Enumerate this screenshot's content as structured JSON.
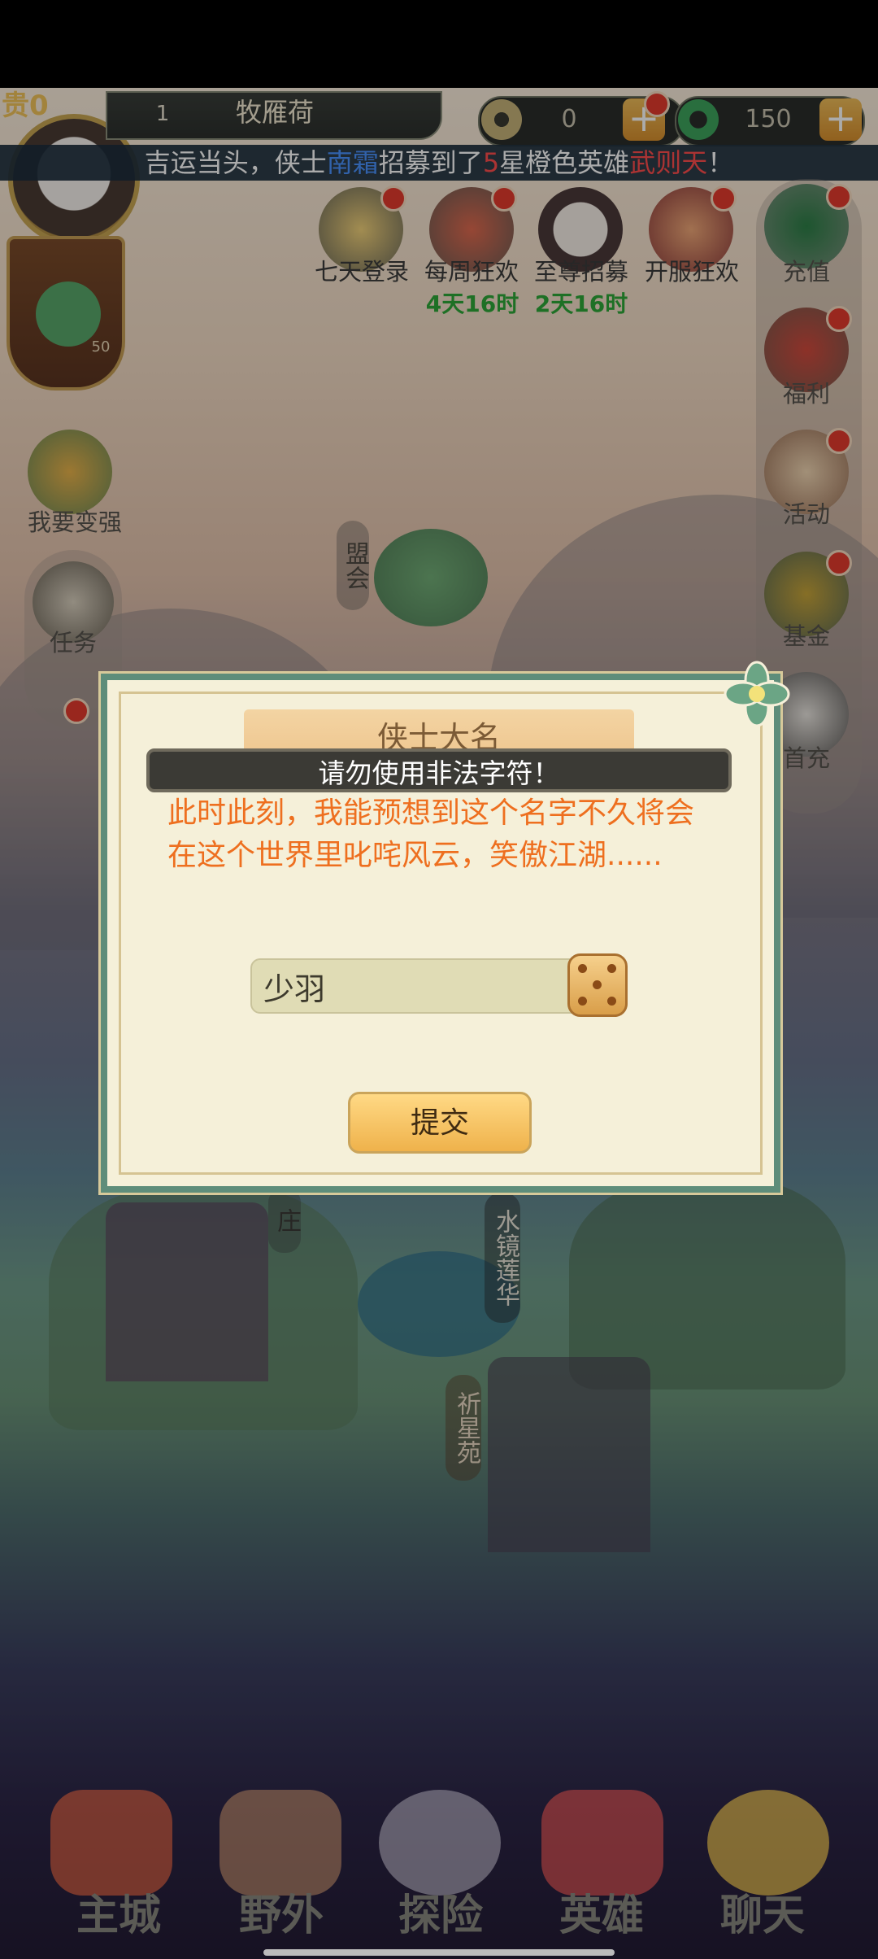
{
  "topbar": {
    "vip_label": "贵0",
    "level": "1",
    "player_name": "牧雁荷",
    "copper": "0",
    "jade": "150"
  },
  "marquee": {
    "part1": "吉运当头，侠士",
    "player": "南霜",
    "part2": "招募到了",
    "stars": "5",
    "part3": "星橙色英雄",
    "hero": "武则天",
    "part4": "！"
  },
  "events": [
    {
      "label": "七天登录",
      "timer": ""
    },
    {
      "label": "每周狂欢",
      "timer": "4天16时"
    },
    {
      "label": "至尊招募",
      "timer": "2天16时"
    },
    {
      "label": "开服狂欢",
      "timer": ""
    }
  ],
  "left_panel": {
    "bonus_count": "50",
    "strengthen_label": "我要变强",
    "task_label": "任务"
  },
  "right_panel": [
    {
      "label": "充值"
    },
    {
      "label": "福利"
    },
    {
      "label": "活动"
    },
    {
      "label": "基金"
    },
    {
      "label": "首充"
    }
  ],
  "map_labels": {
    "alliance": "盟会",
    "village": "庄",
    "mirror": "水镜莲华",
    "star": "祈星苑"
  },
  "dialog": {
    "title": "侠士大名",
    "toast": "请勿使用非法字符！",
    "line1": "此时此刻，我能预想到这个名字不久将会",
    "line2": "在这个世界里叱咤风云，笑傲江湖......",
    "name_value": "少羽",
    "submit_label": "提交"
  },
  "nav": [
    {
      "label": "主城"
    },
    {
      "label": "野外"
    },
    {
      "label": "探险"
    },
    {
      "label": "英雄"
    },
    {
      "label": "聊天"
    }
  ],
  "colors": {
    "accent_orange": "#ee6f1f",
    "dialog_border": "#5e8d7a",
    "button_gold": "#efb24b",
    "timer_green": "#2ea838",
    "highlight_blue": "#4a93ff",
    "highlight_red": "#ff4d4d"
  }
}
